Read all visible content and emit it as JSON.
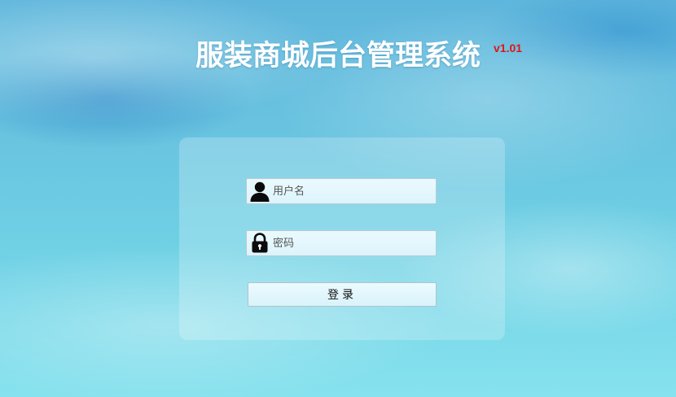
{
  "header": {
    "title": "服装商城后台管理系统",
    "version": "v1.01",
    "version_color": "#e01515"
  },
  "login_form": {
    "username": {
      "placeholder": "用户名",
      "value": "",
      "icon": "user-icon"
    },
    "password": {
      "placeholder": "密码",
      "value": "",
      "icon": "lock-icon"
    },
    "submit_label": "登录"
  }
}
